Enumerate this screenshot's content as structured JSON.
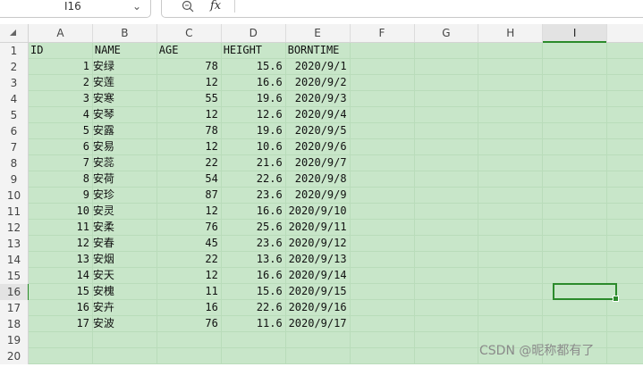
{
  "formula_bar": {
    "name_box": "I16",
    "fx_label": "fx"
  },
  "columns": [
    "A",
    "B",
    "C",
    "D",
    "E",
    "F",
    "G",
    "H",
    "I"
  ],
  "selected_column": "I",
  "rows": [
    {
      "n": "1",
      "id": "ID",
      "name": "NAME",
      "age": "AGE",
      "height": "HEIGHT",
      "born": "BORNTIME"
    },
    {
      "n": "2",
      "id": "1",
      "name": "安绿",
      "age": "78",
      "height": "15.6",
      "born": "2020/9/1"
    },
    {
      "n": "3",
      "id": "2",
      "name": "安莲",
      "age": "12",
      "height": "16.6",
      "born": "2020/9/2"
    },
    {
      "n": "4",
      "id": "3",
      "name": "安寒",
      "age": "55",
      "height": "19.6",
      "born": "2020/9/3"
    },
    {
      "n": "5",
      "id": "4",
      "name": "安琴",
      "age": "12",
      "height": "12.6",
      "born": "2020/9/4"
    },
    {
      "n": "6",
      "id": "5",
      "name": "安露",
      "age": "78",
      "height": "19.6",
      "born": "2020/9/5"
    },
    {
      "n": "7",
      "id": "6",
      "name": "安易",
      "age": "12",
      "height": "10.6",
      "born": "2020/9/6"
    },
    {
      "n": "8",
      "id": "7",
      "name": "安蕊",
      "age": "22",
      "height": "21.6",
      "born": "2020/9/7"
    },
    {
      "n": "9",
      "id": "8",
      "name": "安荷",
      "age": "54",
      "height": "22.6",
      "born": "2020/9/8"
    },
    {
      "n": "10",
      "id": "9",
      "name": "安珍",
      "age": "87",
      "height": "23.6",
      "born": "2020/9/9"
    },
    {
      "n": "11",
      "id": "10",
      "name": "安灵",
      "age": "12",
      "height": "16.6",
      "born": "2020/9/10"
    },
    {
      "n": "12",
      "id": "11",
      "name": "安柔",
      "age": "76",
      "height": "25.6",
      "born": "2020/9/11"
    },
    {
      "n": "13",
      "id": "12",
      "name": "安春",
      "age": "45",
      "height": "23.6",
      "born": "2020/9/12"
    },
    {
      "n": "14",
      "id": "13",
      "name": "安烟",
      "age": "22",
      "height": "13.6",
      "born": "2020/9/13"
    },
    {
      "n": "15",
      "id": "14",
      "name": "安天",
      "age": "12",
      "height": "16.6",
      "born": "2020/9/14"
    },
    {
      "n": "16",
      "id": "15",
      "name": "安槐",
      "age": "11",
      "height": "15.6",
      "born": "2020/9/15"
    },
    {
      "n": "17",
      "id": "16",
      "name": "安卉",
      "age": "16",
      "height": "22.6",
      "born": "2020/9/16"
    },
    {
      "n": "18",
      "id": "17",
      "name": "安波",
      "age": "76",
      "height": "11.6",
      "born": "2020/9/17"
    },
    {
      "n": "19",
      "id": "",
      "name": "",
      "age": "",
      "height": "",
      "born": ""
    },
    {
      "n": "20",
      "id": "",
      "name": "",
      "age": "",
      "height": "",
      "born": ""
    }
  ],
  "selected_row": "16",
  "watermark": "CSDN @昵称都有了",
  "colors": {
    "cell_fill": "#c8e6c9",
    "selection": "#2b8a2b",
    "header_bg": "#f3f3f3"
  },
  "icons": [
    "zoom-icon",
    "fx-icon",
    "dropdown-arrow-icon",
    "select-all-icon"
  ]
}
